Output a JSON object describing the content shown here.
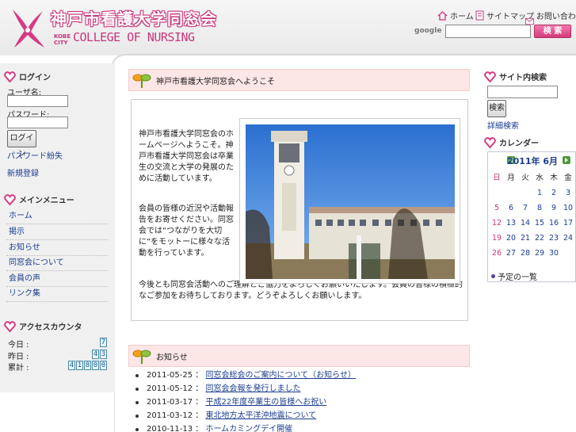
{
  "header": {
    "title": "神戸市看護大学同窓会",
    "kobe_city": "KOBE\nCITY",
    "college": "COLLEGE OF NURSING",
    "links": [
      "ホーム",
      "サイトマップ",
      "お問い合わせ"
    ],
    "google_label": "google",
    "search_button": "検 索"
  },
  "left": {
    "login": {
      "title": "ログイン",
      "user_label": "ユーザ名:",
      "pass_label": "パスワード:",
      "submit": "ログイン",
      "lost_pass": "パスワード紛失",
      "register": "新規登録"
    },
    "menu": {
      "title": "メインメニュー",
      "items": [
        "ホーム",
        "掲示",
        "お知らせ",
        "同窓会について",
        "会員の声",
        "リンク集"
      ]
    },
    "counter": {
      "title": "アクセスカウンタ",
      "rows": [
        {
          "label": "今日 :",
          "value": "7"
        },
        {
          "label": "昨日 :",
          "value": "43"
        },
        {
          "label": "累計 :",
          "value": "41800"
        }
      ]
    }
  },
  "center": {
    "welcome_title": "神戸市看護大学同窓会へようこそ",
    "paragraphs": [
      "神戸市看護大学同窓会のホームページへようこそ。神戸市看護大学同窓会は卒業生の交流と大学の発展のために活動しています。",
      "会員の皆様の近況や活動報告をお寄せください。同窓会では“つながりを大切に”をモットーに様々な活動を行っています。",
      "今後とも同窓会活動へのご理解とご協力をよろしくお願いいたします。会員の皆様の積極的なご参加をお待ちしております。どうぞよろしくお願いします。"
    ],
    "news_title": "お知らせ",
    "news": [
      {
        "date": "2011-05-25",
        "title": "同窓会総会のご案内について（お知らせ）"
      },
      {
        "date": "2011-05-12",
        "title": "同窓会会報を発行しました"
      },
      {
        "date": "2011-03-17",
        "title": "平成22年度卒業生の皆様へお祝い"
      },
      {
        "date": "2011-03-12",
        "title": "東北地方太平洋沖地震について"
      },
      {
        "date": "2010-11-13",
        "title": "ホームカミングデイ開催"
      }
    ]
  },
  "right": {
    "search": {
      "title": "サイト内検索",
      "button": "検索",
      "advanced": "詳細検索"
    },
    "calendar": {
      "title": "カレンダー",
      "month": "2011年 6月",
      "weekdays": [
        "日",
        "月",
        "火",
        "水",
        "木",
        "金",
        "土"
      ],
      "weeks": [
        [
          "",
          "",
          "",
          "1",
          "2",
          "3",
          "4"
        ],
        [
          "5",
          "6",
          "7",
          "8",
          "9",
          "10",
          "11"
        ],
        [
          "12",
          "13",
          "14",
          "15",
          "16",
          "17",
          "18"
        ],
        [
          "19",
          "20",
          "21",
          "22",
          "23",
          "24",
          "25"
        ],
        [
          "26",
          "27",
          "28",
          "29",
          "30",
          "",
          ""
        ]
      ],
      "footer": "予定の一覧"
    }
  }
}
